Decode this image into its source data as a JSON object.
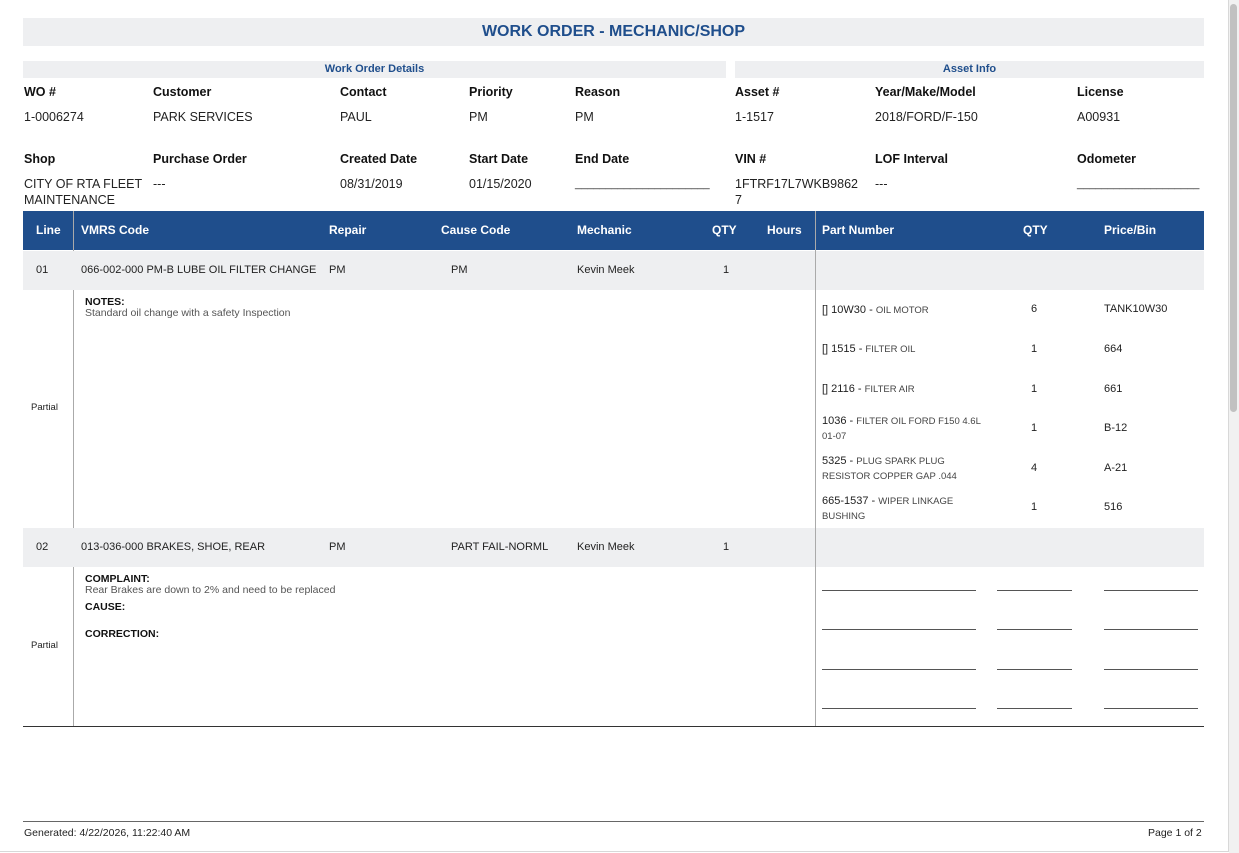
{
  "title": "WORK ORDER - MECHANIC/SHOP",
  "sections": {
    "details": "Work Order Details",
    "asset": "Asset Info"
  },
  "info_row1": {
    "wo_label": "WO #",
    "wo_value": "1-0006274",
    "customer_label": "Customer",
    "customer_value": "PARK SERVICES",
    "contact_label": "Contact",
    "contact_value": "PAUL",
    "priority_label": "Priority",
    "priority_value": "PM",
    "reason_label": "Reason",
    "reason_value": "PM",
    "asset_label": "Asset #",
    "asset_value": "1-1517",
    "ymm_label": "Year/Make/Model",
    "ymm_value": "2018/FORD/F-150",
    "license_label": "License",
    "license_value": "A00931"
  },
  "info_row2": {
    "shop_label": "Shop",
    "shop_value_1": "CITY OF RTA FLEET",
    "shop_value_2": "MAINTENANCE",
    "po_label": "Purchase Order",
    "po_value": "---",
    "created_label": "Created Date",
    "created_value": "08/31/2019",
    "start_label": "Start Date",
    "start_value": "01/15/2020",
    "end_label": "End Date",
    "end_value": "______________________",
    "vin_label": "VIN #",
    "vin_value_1": "1FTRF17L7WKB9862",
    "vin_value_2": "7",
    "lof_label": "LOF Interval",
    "lof_value": "---",
    "odometer_label": "Odometer",
    "odometer_value": "____________________"
  },
  "columns": {
    "line": "Line",
    "vmrs": "VMRS Code",
    "repair": "Repair",
    "cause": "Cause Code",
    "mechanic": "Mechanic",
    "qty": "QTY",
    "hours": "Hours",
    "part_number": "Part Number",
    "part_qty": "QTY",
    "price_bin": "Price/Bin"
  },
  "lines": [
    {
      "line": "01",
      "vmrs": "066-002-000 PM-B LUBE OIL FILTER CHANGE",
      "repair": "PM",
      "cause": "PM",
      "mechanic": "Kevin Meek",
      "qty": "1",
      "status": "Partial",
      "notes_label": "NOTES:",
      "notes": "Standard oil change with a safety Inspection",
      "parts": [
        {
          "num": "[] 10W30",
          "desc": "OIL MOTOR",
          "qty": "6",
          "bin": "TANK10W30"
        },
        {
          "num": "[] 1515",
          "desc": "FILTER OIL",
          "qty": "1",
          "bin": "664"
        },
        {
          "num": "[] 2116",
          "desc": "FILTER AIR",
          "qty": "1",
          "bin": "661"
        },
        {
          "num": "1036",
          "desc": "FILTER OIL FORD F150 4.6L 01-07",
          "qty": "1",
          "bin": "B-12"
        },
        {
          "num": "5325",
          "desc": "PLUG SPARK PLUG RESISTOR COPPER GAP .044",
          "qty": "4",
          "bin": "A-21"
        },
        {
          "num": "665-1537",
          "desc": "WIPER LINKAGE BUSHING",
          "qty": "1",
          "bin": "516"
        }
      ]
    },
    {
      "line": "02",
      "vmrs": "013-036-000 BRAKES, SHOE, REAR",
      "repair": "PM",
      "cause": "PART FAIL-NORML",
      "mechanic": "Kevin Meek",
      "qty": "1",
      "status": "Partial",
      "complaint_label": "COMPLAINT:",
      "complaint": "Rear Brakes are down to 2% and need to be replaced",
      "cause_label": "CAUSE:",
      "correction_label": "CORRECTION:"
    }
  ],
  "footer": {
    "generated": "Generated: 4/22/2026, 11:22:40 AM",
    "page": "Page 1 of 2"
  }
}
